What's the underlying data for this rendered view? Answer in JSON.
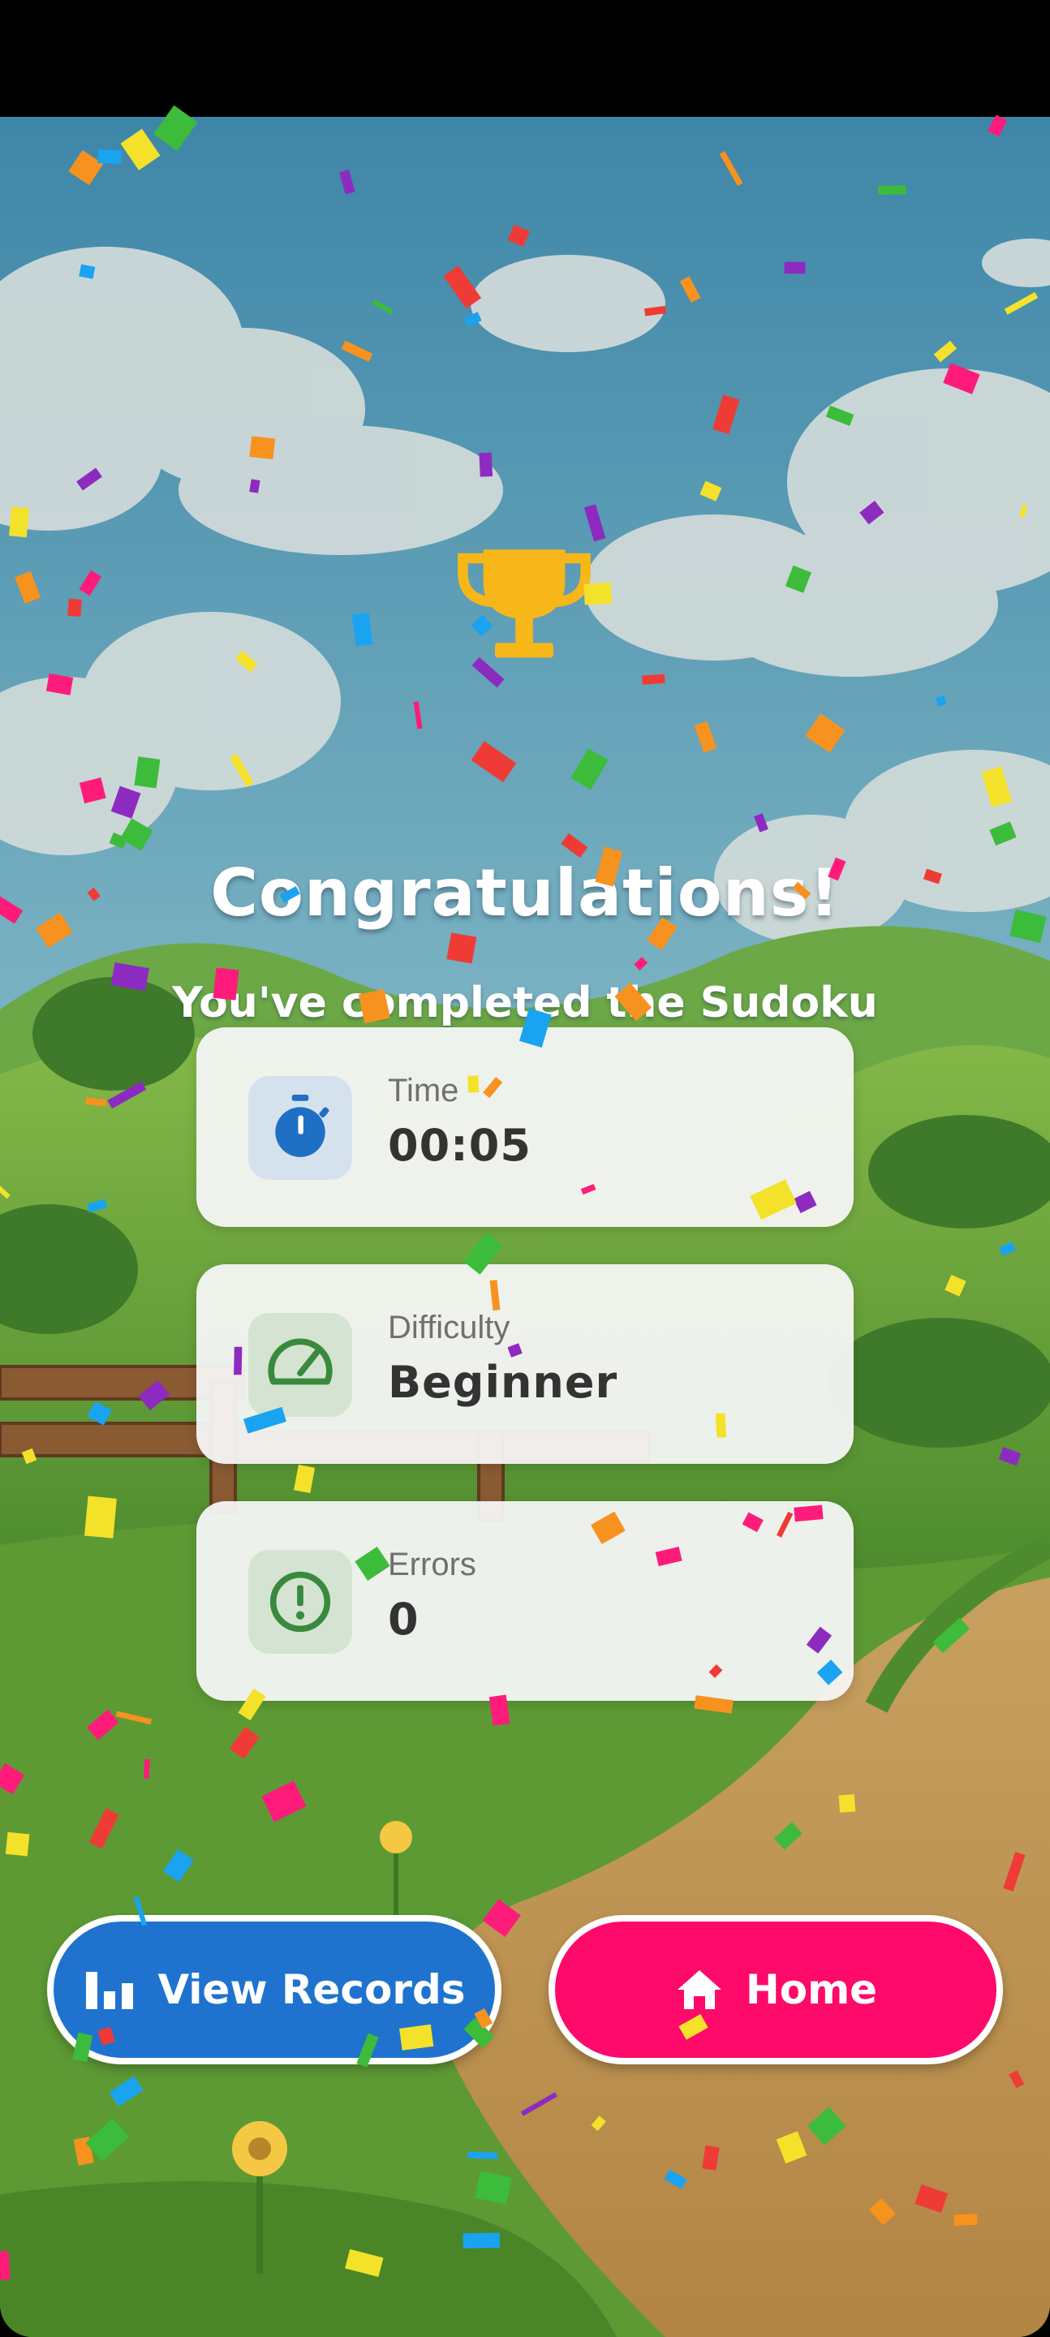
{
  "title": "Congratulations!",
  "subtitle": "You've completed the Sudoku",
  "stats": {
    "time": {
      "label": "Time",
      "value": "00:05",
      "icon": "stopwatch-icon",
      "accent": "#1f6fc4"
    },
    "difficulty": {
      "label": "Difficulty",
      "value": "Beginner",
      "icon": "speedometer-icon",
      "accent": "#3a8a3e"
    },
    "errors": {
      "label": "Errors",
      "value": "0",
      "icon": "alert-circle-icon",
      "accent": "#3a8a3e"
    }
  },
  "buttons": {
    "view_records": {
      "label": "View Records",
      "icon": "bar-chart-icon",
      "color": "#1f73cf"
    },
    "home": {
      "label": "Home",
      "icon": "home-icon",
      "color": "#fe0a6a"
    }
  },
  "colors": {
    "trophy": "#f7b718",
    "sky": "#4d95b4",
    "grass": "#6aa63a"
  }
}
